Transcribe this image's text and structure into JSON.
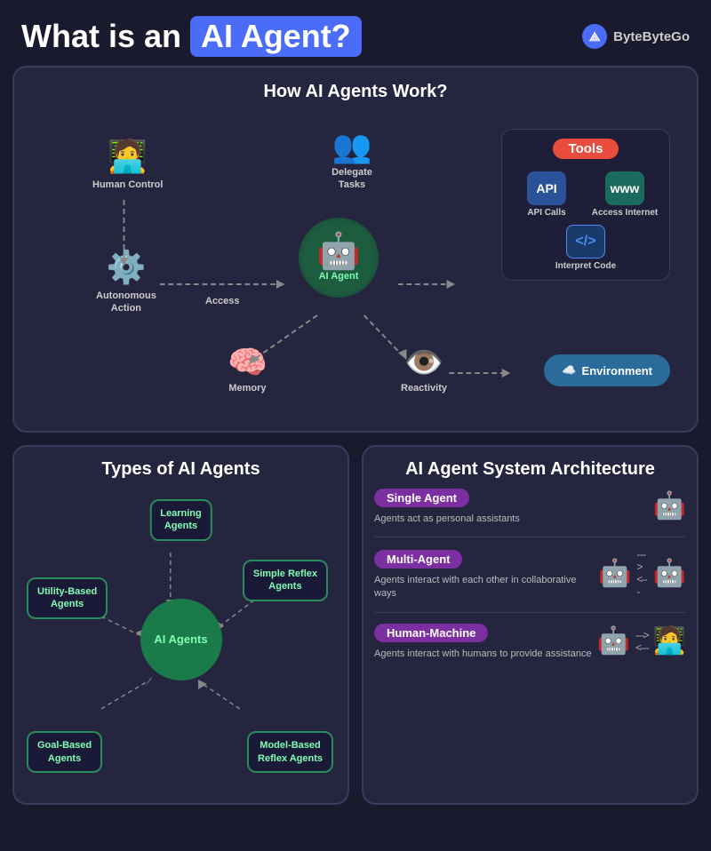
{
  "header": {
    "title_prefix": "What is an",
    "title_highlight": "AI Agent?",
    "brand_name": "ByteByteGo"
  },
  "how_it_works": {
    "title": "How AI Agents Work?",
    "center_label": "AI Agent",
    "items": {
      "human_control": "Human Control",
      "autonomous_action": "Autonomous Action",
      "delegate_tasks": "Delegate Tasks",
      "memory": "Memory",
      "reactivity": "Reactivity",
      "access": "Access"
    },
    "tools": {
      "label": "Tools",
      "api_calls": "API Calls",
      "access_internet": "Access Internet",
      "interpret_code": "Interpret Code"
    },
    "environment": "Environment"
  },
  "types": {
    "title": "Types of AI Agents",
    "center": "AI Agents",
    "agents": [
      "Learning\nAgents",
      "Simple Reflex\nAgents",
      "Utility-Based\nAgents",
      "Goal-Based\nAgents",
      "Model-Based\nReflex Agents"
    ]
  },
  "architecture": {
    "title": "AI Agent System Architecture",
    "items": [
      {
        "badge": "Single Agent",
        "description": "Agents act as personal assistants"
      },
      {
        "badge": "Multi-Agent",
        "description": "Agents interact with each other in collaborative ways"
      },
      {
        "badge": "Human-Machine",
        "description": "Agents interact with humans to provide assistance"
      }
    ]
  }
}
